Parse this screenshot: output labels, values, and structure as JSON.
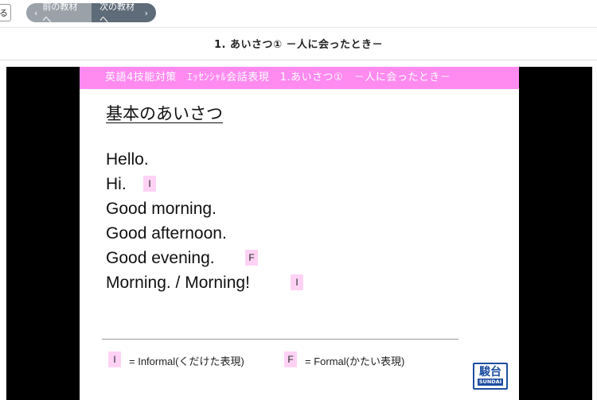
{
  "nav": {
    "back_label": "る",
    "prev_label": "前の教材へ",
    "next_label": "次の教材へ",
    "prev_icon": "chevron-left-icon",
    "next_icon": "chevron-right-icon"
  },
  "page": {
    "title": "1. あいさつ① －人に会ったとき－"
  },
  "slide": {
    "header": "英語4技能対策　ｴｯｾﾝｼｬﾙ会話表現　1.あいさつ①　－人に会ったとき－",
    "heading": "基本のあいさつ",
    "phrases": [
      {
        "text": "Hello.",
        "tag": ""
      },
      {
        "text": "Hi.",
        "tag": "I"
      },
      {
        "text": "Good morning.",
        "tag": ""
      },
      {
        "text": "Good afternoon.",
        "tag": ""
      },
      {
        "text": "Good evening.",
        "tag": "F"
      },
      {
        "text": "Morning. / Morning!",
        "tag": "I"
      }
    ],
    "legend": {
      "informal_tag": "I",
      "informal_text": "= Informal(くだけた表現)",
      "formal_tag": "F",
      "formal_text": "= Formal(かたい表現)"
    },
    "logo": {
      "kanji": "駿台",
      "en": "SUNDAI"
    }
  },
  "colors": {
    "header_bg": "#ff8af0",
    "tag_bg": "#ffd2f5",
    "nav_prev_bg": "#9aa1a9",
    "nav_next_bg": "#5e6b78",
    "logo_blue": "#1d4ea0"
  }
}
